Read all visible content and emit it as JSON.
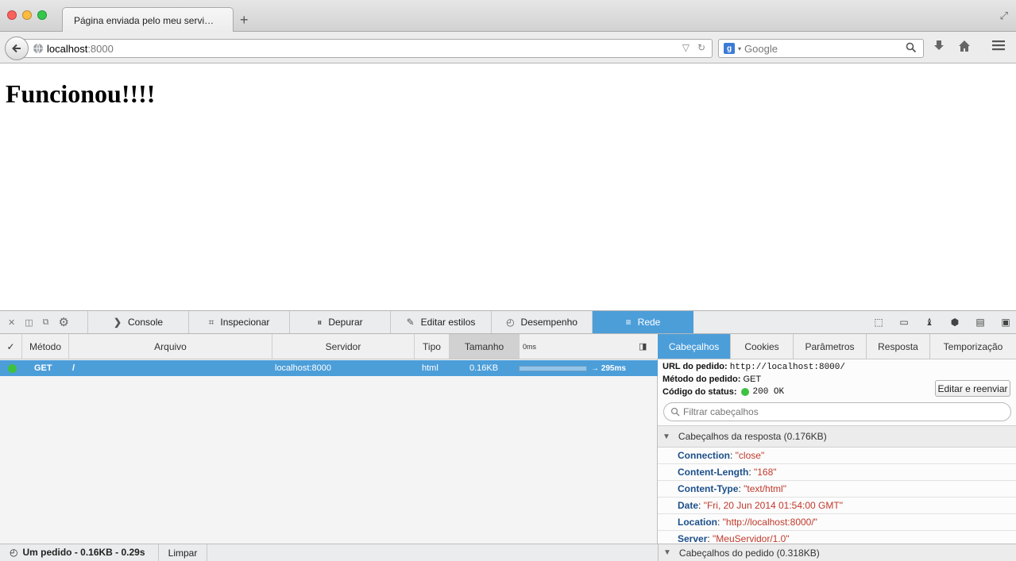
{
  "browser": {
    "tab_title": "Página enviada pelo meu servi…",
    "new_tab": "+",
    "url_host": "localhost",
    "url_port": ":8000",
    "search_placeholder": "Google",
    "search_logo": "g"
  },
  "page": {
    "heading": "Funcionou!!!!"
  },
  "devtools": {
    "tabs": [
      "Console",
      "Inspecionar",
      "Depurar",
      "Editar estilos",
      "Desempenho",
      "Rede"
    ],
    "active_tab": "Rede",
    "network": {
      "check_col": "✓",
      "columns": [
        "Método",
        "Arquivo",
        "Servidor",
        "Tipo",
        "Tamanho",
        "0ms"
      ],
      "sorted_column": "Tamanho",
      "rows": [
        {
          "method": "GET",
          "file": "/",
          "server": "localhost:8000",
          "type": "html",
          "size": "0.16KB",
          "time": "→ 295ms",
          "status_color": "#3ec13e"
        }
      ]
    },
    "details": {
      "tabs": [
        "Cabeçalhos",
        "Cookies",
        "Parâmetros",
        "Resposta",
        "Temporização"
      ],
      "active_tab": "Cabeçalhos",
      "url_label": "URL do pedido:",
      "url_value": "http://localhost:8000/",
      "method_label": "Método do pedido:",
      "method_value": "GET",
      "status_label": "Código do status:",
      "status_value": "200 OK",
      "resend_label": "Editar e reenviar",
      "filter_placeholder": "Filtrar cabeçalhos",
      "response_section": "Cabeçalhos da resposta (0.176KB)",
      "response_headers": [
        {
          "name": "Connection",
          "value": "\"close\""
        },
        {
          "name": "Content-Length",
          "value": "\"168\""
        },
        {
          "name": "Content-Type",
          "value": "\"text/html\""
        },
        {
          "name": "Date",
          "value": "\"Fri, 20 Jun 2014 01:54:00 GMT\""
        },
        {
          "name": "Location",
          "value": "\"http://localhost:8000/\""
        },
        {
          "name": "Server",
          "value": "\"MeuServidor/1.0\""
        }
      ],
      "request_section": "Cabeçalhos do pedido (0.318KB)"
    },
    "status": {
      "summary": "Um pedido - 0.16KB - 0.29s",
      "clear_label": "Limpar"
    }
  },
  "colors": {
    "accent": "#4c9ed9",
    "status_ok": "#3ec13e",
    "header_name": "#1b4f8a",
    "header_value": "#c0392b"
  }
}
